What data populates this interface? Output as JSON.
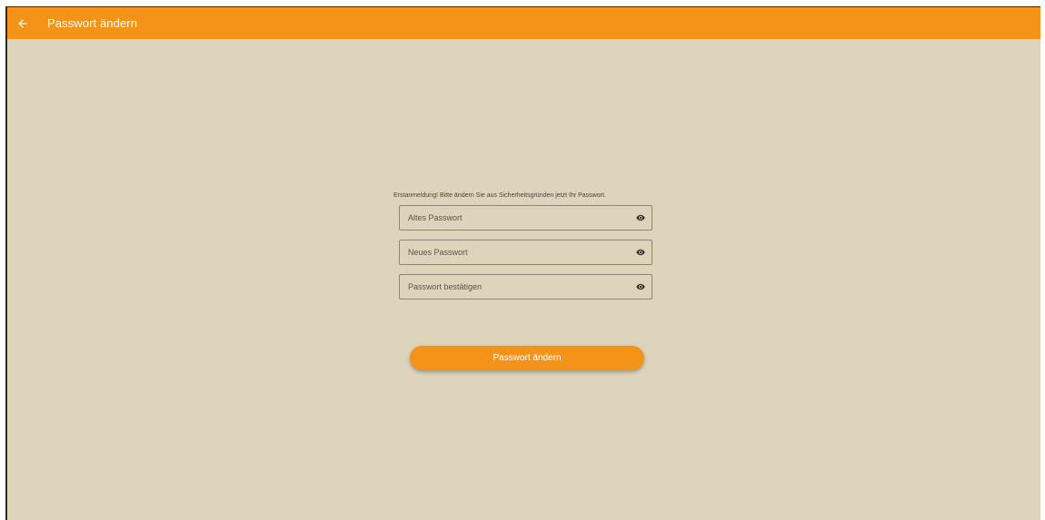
{
  "appbar": {
    "title": "Passwort ändern",
    "back_icon": "arrow-left-icon",
    "color": "#f39419"
  },
  "form": {
    "info_text": "Erstanmeldung! Bitte ändern Sie aus Sicherheitsgründen jetzt Ihr Passwort.",
    "fields": [
      {
        "placeholder": "Altes Passwort",
        "value": "",
        "icon": "eye-icon"
      },
      {
        "placeholder": "Neues Passwort",
        "value": "",
        "icon": "eye-icon"
      },
      {
        "placeholder": "Passwort bestätigen",
        "value": "",
        "icon": "eye-icon"
      }
    ],
    "submit_label": "Passwort ändern"
  },
  "colors": {
    "background": "#ded4bc",
    "accent": "#f39419"
  }
}
